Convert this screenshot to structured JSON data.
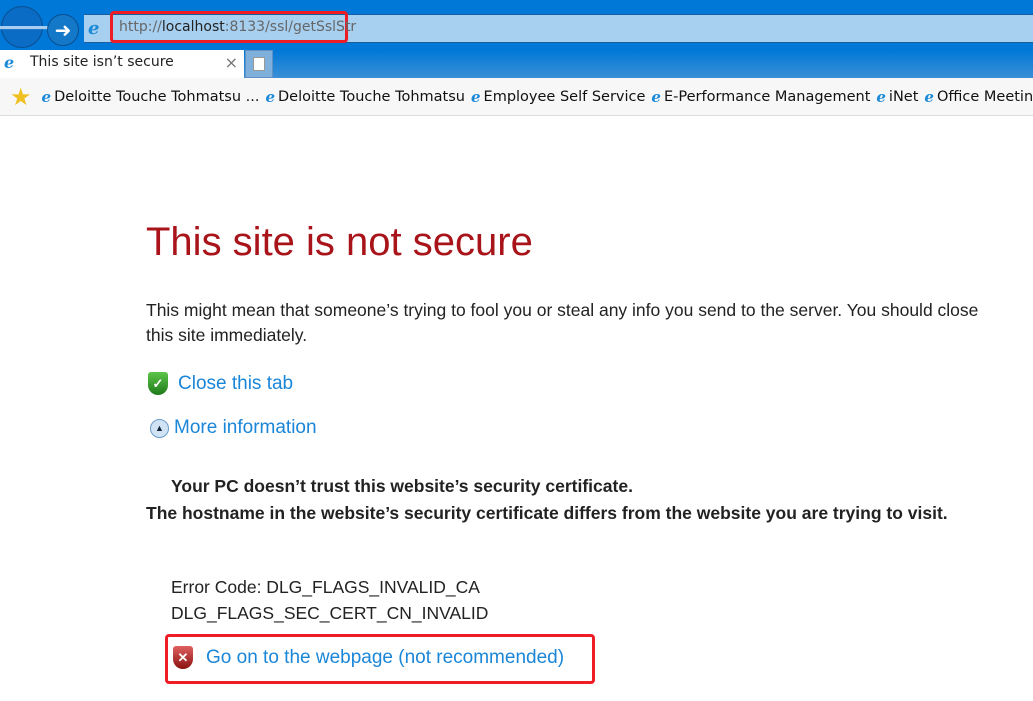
{
  "browser": {
    "address": {
      "scheme": "http://",
      "host": "localhost",
      "rest": ":8133/ssl/getSslStr"
    },
    "tab": {
      "title": "This site isn’t secure",
      "close": "×"
    },
    "favorites": [
      "Deloitte Touche Tohmatsu ...",
      "Deloitte Touche Tohmatsu",
      "Employee Self Service",
      "E-Performance Management",
      "iNet",
      "Office Meeting"
    ],
    "icons": {
      "back": "back-arrow-icon",
      "forward": "forward-arrow-icon",
      "ie": "internet-explorer-icon",
      "favorites": "favorites-star-icon"
    }
  },
  "page": {
    "title": "This site is not secure",
    "message": "This might mean that someone’s trying to fool you or steal any info you send to the server. You should close this site immediately.",
    "close_tab": "Close this tab",
    "more_info": "More information",
    "cert_warning": "Your PC doesn’t trust this website’s security certificate.",
    "hostname_warning": "The hostname in the website’s security certificate differs from the website you are trying to visit.",
    "error_code_1": "Error Code: DLG_FLAGS_INVALID_CA",
    "error_code_2": "DLG_FLAGS_SEC_CERT_CN_INVALID",
    "go_on": "Go on to the webpage (not recommended)"
  },
  "colors": {
    "title": "#a8141a",
    "link": "#1a86d8",
    "highlight": "#ee1c24",
    "chrome": "#0078d7"
  }
}
